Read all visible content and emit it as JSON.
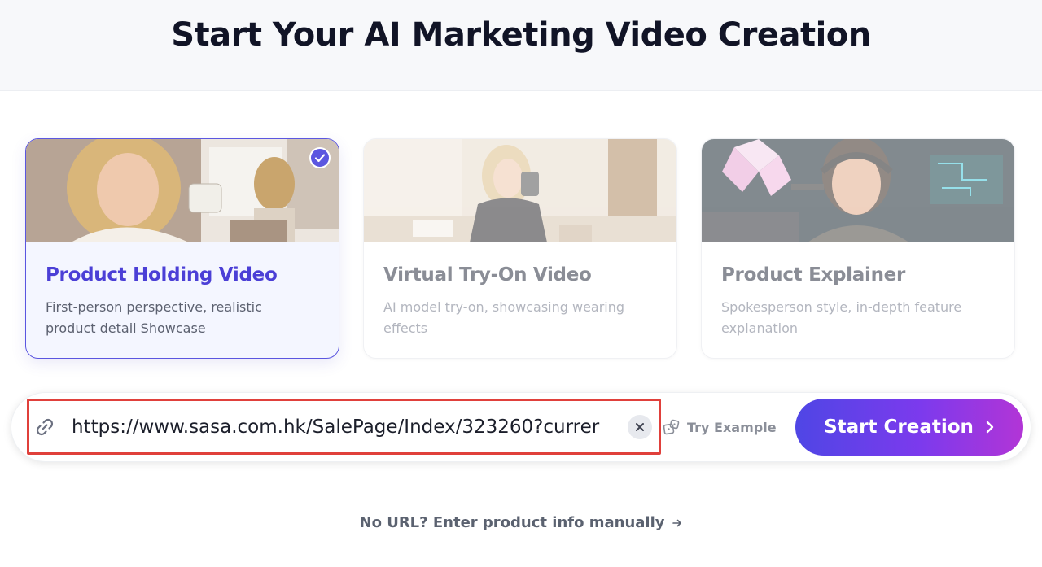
{
  "header": {
    "title": "Start Your AI Marketing Video Creation"
  },
  "cards": [
    {
      "title": "Product Holding Video",
      "description": "First-person perspective, realistic product detail Showcase",
      "selected": true
    },
    {
      "title": "Virtual Try-On Video",
      "description": "AI model try-on, showcasing wearing effects",
      "selected": false
    },
    {
      "title": "Product Explainer",
      "description": "Spokesperson style, in-depth feature explanation",
      "selected": false
    }
  ],
  "url_bar": {
    "value": "https://www.sasa.com.hk/SalePage/Index/323260?currer",
    "try_example_label": "Try Example",
    "start_button_label": "Start Creation"
  },
  "footer": {
    "manual_link_label": "No URL? Enter product info manually"
  },
  "colors": {
    "accent": "#5b56e0",
    "highlight_border": "#e0403b",
    "button_gradient_start": "#4f46e5",
    "button_gradient_end": "#b235d6"
  },
  "icons": {
    "url_field": "link-icon",
    "clear": "close-icon",
    "try_example": "dice-icon",
    "start_button": "chevron-right-icon",
    "manual_link": "arrow-right-icon",
    "selected_card": "check-icon"
  }
}
